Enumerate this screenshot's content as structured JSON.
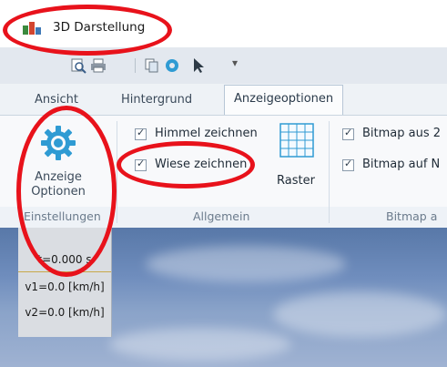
{
  "window": {
    "title": "3D Darstellung",
    "app_icon": "bar-chart-icon"
  },
  "quick_access": {
    "items": [
      "print-preview-icon",
      "printer-icon",
      "copy-icon",
      "gear-icon",
      "cursor-icon"
    ],
    "dropdown_glyph": "▾"
  },
  "ribbon": {
    "tabs": [
      "Ansicht",
      "Hintergrund",
      "Anzeigeoptionen"
    ],
    "active_tab": "Anzeigeoptionen",
    "groups": {
      "einstellungen": {
        "button_label_line1": "Anzeige",
        "button_label_line2": "Optionen",
        "label": "Einstellungen"
      },
      "allgemein": {
        "checkbox_sky": "Himmel zeichnen",
        "checkbox_meadow": "Wiese zeichnen",
        "grid_button": "Raster",
        "label": "Allgemein"
      },
      "bitmap": {
        "checkbox_bitmap_from": "Bitmap aus 2",
        "checkbox_bitmap_to": "Bitmap auf N",
        "label": "Bitmap a"
      }
    }
  },
  "status": {
    "time": "t=0.000 s",
    "v1": "v1=0.0 [km/h]",
    "v2": "v2=0.0 [km/h]"
  },
  "colors": {
    "annotation": "#e8121b",
    "accent": "#2f9bd3"
  }
}
